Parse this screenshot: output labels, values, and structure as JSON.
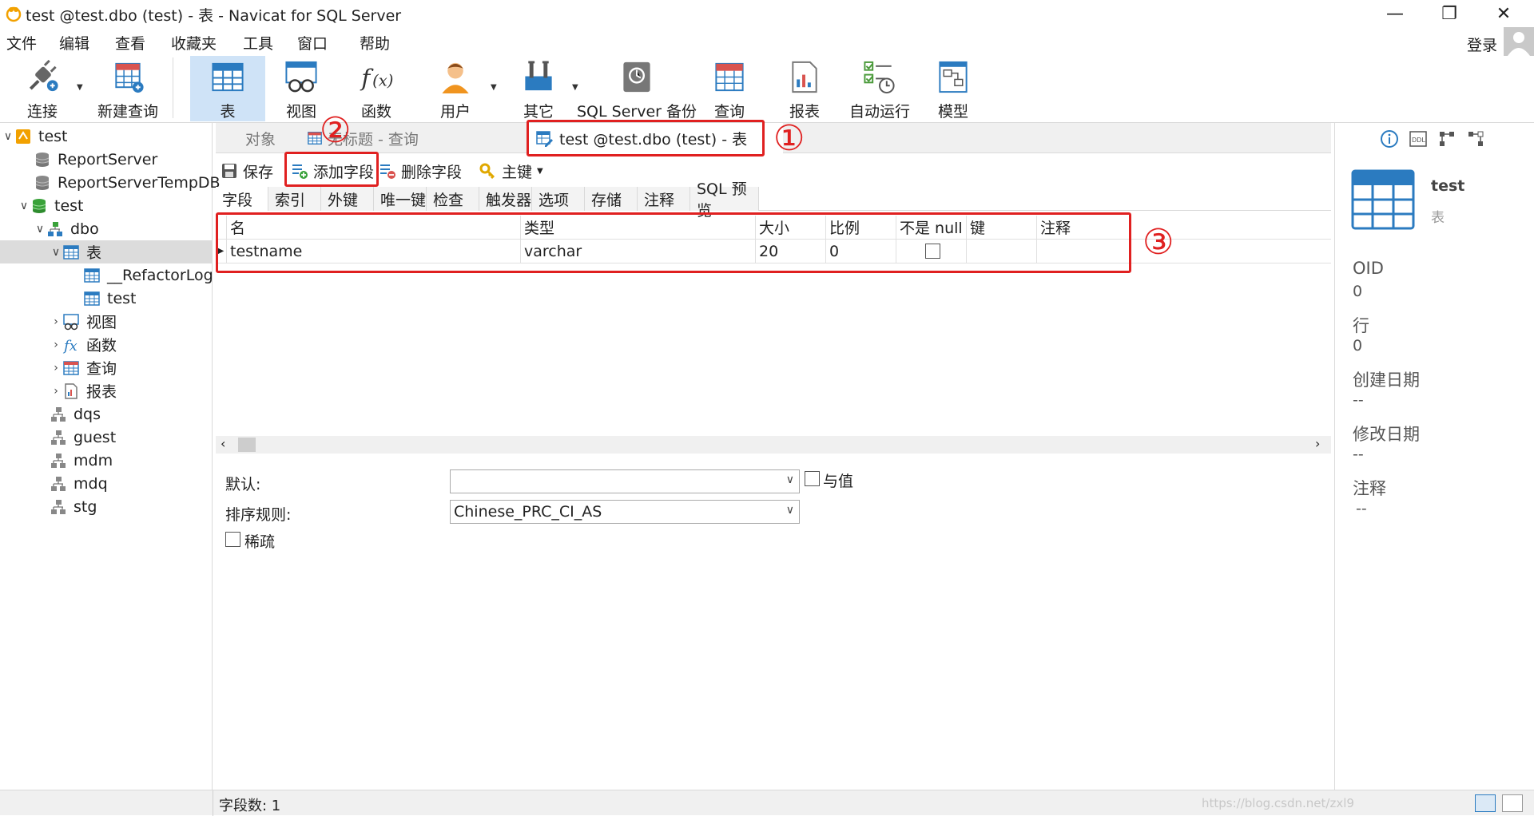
{
  "window": {
    "title": "test @test.dbo (test) - 表 - Navicat for SQL Server",
    "controls": [
      "minimize",
      "restore",
      "close"
    ]
  },
  "menu": {
    "items": [
      "文件",
      "编辑",
      "查看",
      "收藏夹",
      "工具",
      "窗口",
      "帮助"
    ],
    "login": "登录"
  },
  "toolbar": {
    "connect": "连接",
    "new_query": "新建查询",
    "table": "表",
    "view": "视图",
    "function": "函数",
    "user": "用户",
    "other": "其它",
    "backup": "SQL Server 备份",
    "query": "查询",
    "report": "报表",
    "automation": "自动运行",
    "model": "模型"
  },
  "nav": {
    "items": [
      {
        "label": "test",
        "icon": "server-icon"
      },
      {
        "label": "ReportServer",
        "icon": "database-icon"
      },
      {
        "label": "ReportServerTempDB",
        "icon": "database-icon"
      },
      {
        "label": "test",
        "icon": "database-icon"
      },
      {
        "label": "dbo",
        "icon": "schema-icon"
      },
      {
        "label": "表",
        "icon": "table-icon"
      },
      {
        "label": "__RefactorLog",
        "icon": "table-icon"
      },
      {
        "label": "test",
        "icon": "table-icon"
      },
      {
        "label": "视图",
        "icon": "view-icon"
      },
      {
        "label": "函数",
        "icon": "function-icon"
      },
      {
        "label": "查询",
        "icon": "query-icon"
      },
      {
        "label": "报表",
        "icon": "report-icon"
      },
      {
        "label": "dqs",
        "icon": "schema-icon"
      },
      {
        "label": "guest",
        "icon": "schema-icon"
      },
      {
        "label": "mdm",
        "icon": "schema-icon"
      },
      {
        "label": "mdq",
        "icon": "schema-icon"
      },
      {
        "label": "stg",
        "icon": "schema-icon"
      }
    ]
  },
  "tabs": {
    "objects": "对象",
    "untitled_query": "无标题 - 查询",
    "table_editor": "test @test.dbo (test) - 表"
  },
  "editor_toolbar": {
    "save": "保存",
    "add_field": "添加字段",
    "delete_field": "删除字段",
    "primary_key": "主键"
  },
  "subtabs": [
    "字段",
    "索引",
    "外键",
    "唯一键",
    "检查",
    "触发器",
    "选项",
    "存储",
    "注释",
    "SQL 预览"
  ],
  "grid": {
    "headers": [
      "名",
      "类型",
      "大小",
      "比例",
      "不是 null",
      "键",
      "注释"
    ],
    "rows": [
      {
        "name": "testname",
        "type": "varchar",
        "size": "20",
        "scale": "0",
        "not_null": false,
        "key": "",
        "comment": ""
      }
    ]
  },
  "properties": {
    "default_label": "默认:",
    "default_value": "",
    "expression_label": "与值",
    "collation_label": "排序规则:",
    "collation_value": "Chinese_PRC_CI_AS",
    "sparse_label": "稀疏"
  },
  "info": {
    "name": "test",
    "type": "表",
    "oid_label": "OID",
    "oid_value": "0",
    "rows_label": "行",
    "rows_value": "0",
    "created_label": "创建日期",
    "created_value": "--",
    "modified_label": "修改日期",
    "modified_value": "--",
    "comment_label": "注释",
    "comment_value": "--"
  },
  "status": {
    "field_count": "字段数: 1",
    "watermark": "https://blog.csdn.net/zxl9"
  },
  "annotations": {
    "one": "①",
    "two": "②",
    "three": "③"
  },
  "colors": {
    "accent": "#2b7bc0",
    "annotation": "#e02020",
    "selected_tool": "#cfe3f7"
  }
}
